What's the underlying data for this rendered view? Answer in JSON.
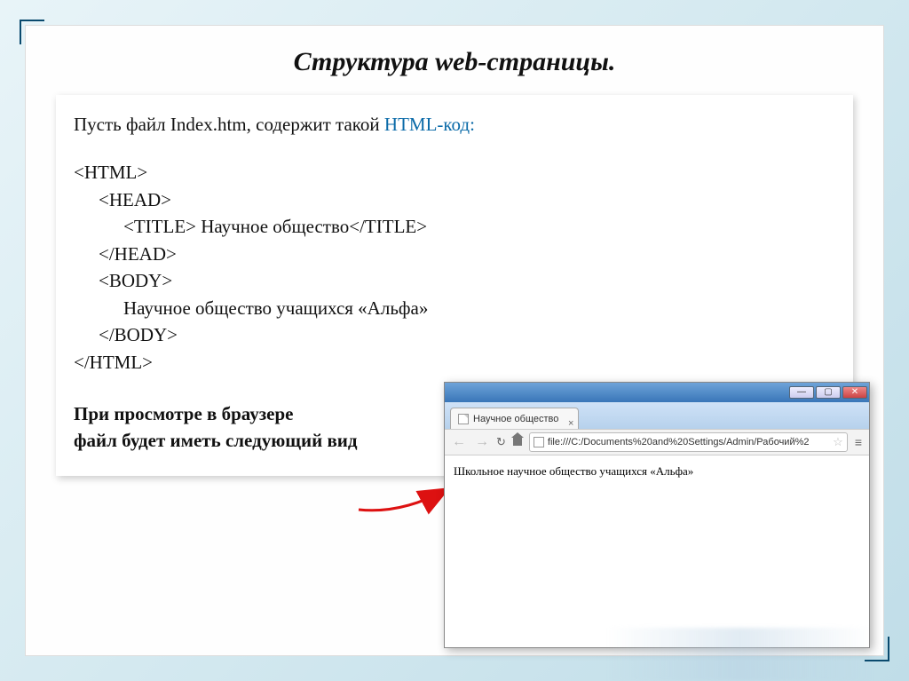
{
  "title": "Структура web-страницы.",
  "intro_prefix": "Пусть  файл Index.htm, содержит такой ",
  "intro_hl": "HTML-код:",
  "code": {
    "l1": "<HTML>",
    "l2": "<HEAD>",
    "l3": "<TITLE> Научное общество</TITLE>",
    "l4": "</HEAD>",
    "l5": "<BODY>",
    "l6": "Научное общество учащихся «Альфа»",
    "l7": "</BODY>",
    "l8": "</HTML>"
  },
  "viewnote_l1": "При просмотре в браузере",
  "viewnote_l2": " файл будет иметь следующий вид",
  "browser": {
    "tab_title": "Научное общество",
    "tab_close": "×",
    "win_min": "—",
    "win_max": "▢",
    "win_close": "✕",
    "nav_back": "←",
    "nav_fwd": "→",
    "reload": "↻",
    "address": "file:///C:/Documents%20and%20Settings/Admin/Рабочий%2",
    "star": "☆",
    "menu": "≡",
    "page_body": "Школьное научное общество учащихся «Альфа»"
  }
}
